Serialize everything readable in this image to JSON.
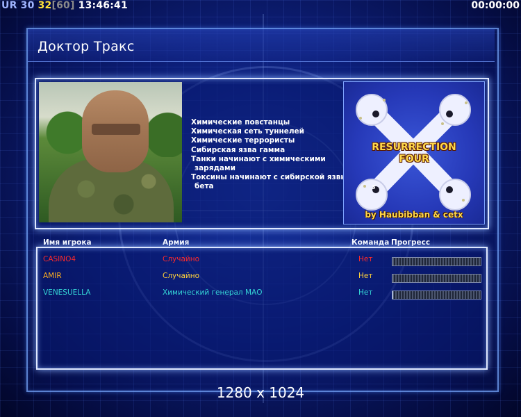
{
  "hud": {
    "ur_label": "UR",
    "ur_value": "30",
    "fps": "32",
    "fps_limit": "[60]",
    "clock": "13:46:41",
    "timer": "00:00:00"
  },
  "map_title": "Доктор Тракс",
  "info_lines": [
    "Химические повстанцы",
    "Химическая сеть туннелей",
    "Химические террористы",
    "Сибирская язва гамма",
    "Танки начинают с химическими",
    "зарядами",
    "Токсины начинают с сибирской язвы",
    "бета"
  ],
  "map_preview": {
    "name_line1": "RESURRECTION",
    "name_line2": "FOUR",
    "credit": "by Haubibban & cetx",
    "start_marker": "3"
  },
  "columns": {
    "player": "Имя игрока",
    "army": "Армия",
    "team": "Команда",
    "progress": "Прогресс"
  },
  "players": [
    {
      "name": "CASINO4",
      "army": "Случайно",
      "team": "Нет",
      "color": "#ff2a2a",
      "army_color": "#ff2a2a",
      "progress": 0.0
    },
    {
      "name": "AMIR",
      "army": "Случайно",
      "team": "Нет",
      "color": "#ffb020",
      "army_color": "#ffd23a",
      "progress": 0.0
    },
    {
      "name": "VENESUELLA",
      "army": "Химический генерал МАО",
      "team": "Нет",
      "color": "#35d6d6",
      "army_color": "#35d6d6",
      "progress": 0.01
    }
  ],
  "resolution": "1280 x 1024"
}
